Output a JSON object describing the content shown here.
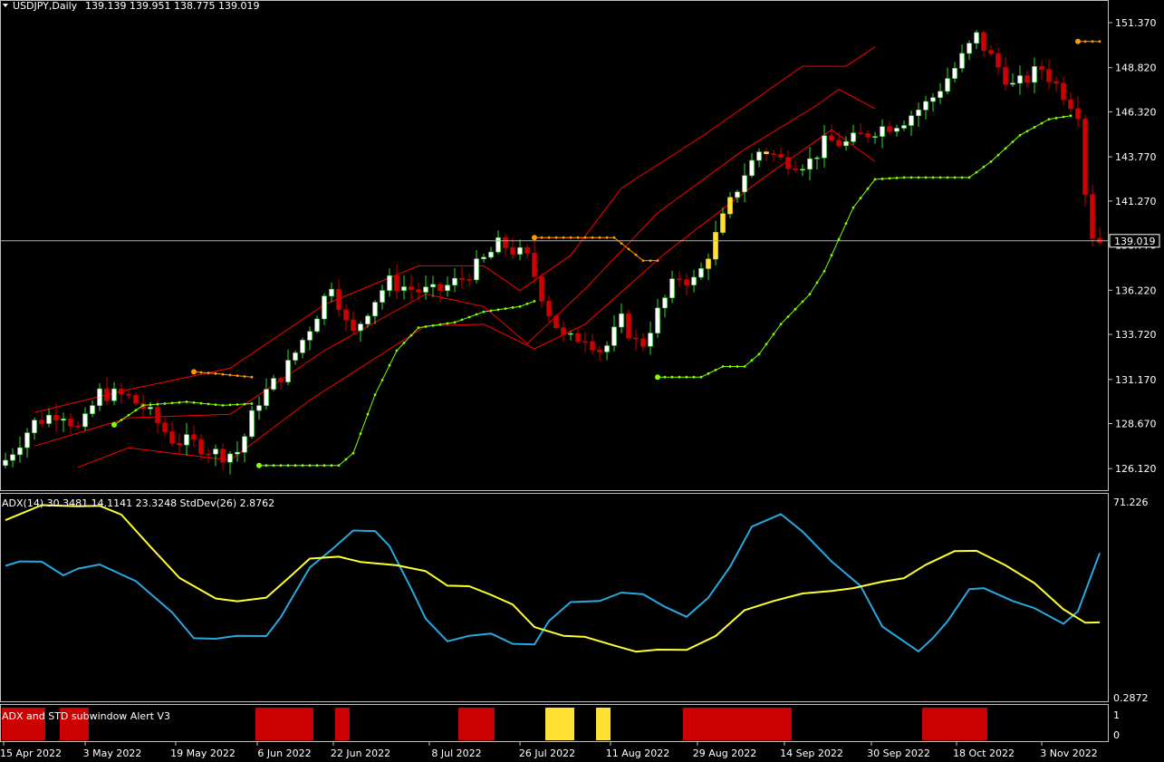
{
  "header": {
    "symbol": "USDJPY,Daily",
    "ohlc": "139.139 139.951 138.775 139.019"
  },
  "sub1_header": "ADX(14) 30.3481 14.1141 23.3248  StdDev(26) 2.8762",
  "sub2_header": "ADX and STD subwindow Alert V3",
  "colors": {
    "background": "#000000",
    "bull_candle": "#ffffff",
    "bear_candle": "#cc0000",
    "highlight_candle": "#ffe033",
    "keltner": "#ff0000",
    "stop_up": "#7fff00",
    "stop_down": "#ff9900",
    "adx_line": "#29a8e0",
    "stddev_line": "#ffff33",
    "alert_red": "#cc0000",
    "alert_yellow": "#ffe033",
    "border": "#c0c0c0"
  },
  "price_axis": {
    "ticks": [
      "151.370",
      "148.820",
      "146.320",
      "143.770",
      "141.270",
      "138.770",
      "136.220",
      "133.720",
      "131.170",
      "128.670",
      "126.120"
    ],
    "current_price": "139.019"
  },
  "sub1_axis": {
    "max": "71.226",
    "min": "0.2872"
  },
  "sub2_axis": {
    "top": "1",
    "bottom": "0"
  },
  "x_axis": {
    "dates": [
      "15 Apr 2022",
      "3 May 2022",
      "19 May 2022",
      "6 Jun 2022",
      "22 Jun 2022",
      "8 Jul 2022",
      "26 Jul 2022",
      "11 Aug 2022",
      "29 Aug 2022",
      "14 Sep 2022",
      "30 Sep 2022",
      "18 Oct 2022",
      "3 Nov 2022"
    ]
  },
  "chart_data": [
    {
      "type": "candlestick",
      "title": "USDJPY,Daily",
      "y_range": [
        124.9,
        152.6
      ],
      "current_price": 139.019,
      "close_path": [
        [
          0,
          126.6
        ],
        [
          3,
          128.7
        ],
        [
          6,
          129.4
        ],
        [
          8,
          128.2
        ],
        [
          10,
          130.4
        ],
        [
          13,
          130.2
        ],
        [
          15,
          129.5
        ],
        [
          18,
          127.7
        ],
        [
          20,
          127.6
        ],
        [
          23,
          126.9
        ],
        [
          25,
          127.1
        ],
        [
          27,
          129.9
        ],
        [
          30,
          131.7
        ],
        [
          33,
          134.5
        ],
        [
          35,
          136.7
        ],
        [
          37,
          133.5
        ],
        [
          39,
          135.3
        ],
        [
          41,
          136.7
        ],
        [
          44,
          136.2
        ],
        [
          46,
          136.1
        ],
        [
          49,
          136.9
        ],
        [
          51,
          137.8
        ],
        [
          53,
          138.9
        ],
        [
          56,
          138.0
        ],
        [
          58,
          135.2
        ],
        [
          60,
          133.3
        ],
        [
          62,
          133.7
        ],
        [
          64,
          132.7
        ],
        [
          66,
          134.5
        ],
        [
          68,
          132.9
        ],
        [
          70,
          135.1
        ],
        [
          72,
          137.0
        ],
        [
          74,
          136.7
        ],
        [
          77,
          140.4
        ],
        [
          79,
          142.7
        ],
        [
          81,
          144.3
        ],
        [
          83,
          143.6
        ],
        [
          86,
          143.4
        ],
        [
          88,
          144.7
        ],
        [
          90,
          144.5
        ],
        [
          93,
          145.3
        ],
        [
          96,
          145.8
        ],
        [
          99,
          146.9
        ],
        [
          102,
          149.0
        ],
        [
          104,
          150.6
        ],
        [
          106,
          149.1
        ],
        [
          108,
          147.7
        ],
        [
          111,
          148.8
        ],
        [
          113,
          147.6
        ],
        [
          115,
          146.3
        ],
        [
          116,
          139.7
        ],
        [
          117,
          139.0
        ]
      ],
      "highlighted_bars": [
        [
          75,
          77
        ],
        [
          81,
          81
        ]
      ],
      "keltner_upper": [
        [
          4,
          129.3
        ],
        [
          17,
          130.6
        ],
        [
          31,
          131.8
        ],
        [
          44,
          135.4
        ],
        [
          57,
          137.6
        ],
        [
          66,
          137.6
        ],
        [
          71,
          136.2
        ],
        [
          78,
          138.2
        ],
        [
          85,
          142.0
        ],
        [
          96,
          144.9
        ],
        [
          110,
          148.9
        ],
        [
          116,
          148.9
        ],
        [
          120,
          150.0
        ]
      ],
      "keltner_middle": [
        [
          4,
          127.4
        ],
        [
          17,
          129.0
        ],
        [
          31,
          129.2
        ],
        [
          44,
          132.8
        ],
        [
          58,
          136.0
        ],
        [
          66,
          135.3
        ],
        [
          72,
          133.2
        ],
        [
          80,
          136.3
        ],
        [
          90,
          140.6
        ],
        [
          102,
          144.2
        ],
        [
          112,
          146.7
        ],
        [
          115,
          147.6
        ],
        [
          120,
          146.5
        ]
      ],
      "keltner_lower": [
        [
          10,
          126.2
        ],
        [
          17,
          127.3
        ],
        [
          31,
          126.6
        ],
        [
          42,
          130.0
        ],
        [
          58,
          134.2
        ],
        [
          66,
          134.3
        ],
        [
          73,
          132.9
        ],
        [
          80,
          134.3
        ],
        [
          91,
          138.3
        ],
        [
          104,
          142.4
        ],
        [
          114,
          145.3
        ],
        [
          120,
          143.5
        ]
      ],
      "stop_dots": [
        {
          "trend": "up",
          "points": [
            [
              15,
              128.6
            ],
            [
              19,
              129.7
            ],
            [
              25,
              129.9
            ],
            [
              30,
              129.7
            ],
            [
              34,
              129.8
            ]
          ]
        },
        {
          "trend": "down",
          "points": [
            [
              26,
              131.6
            ],
            [
              29,
              131.5
            ],
            [
              34,
              131.3
            ]
          ]
        },
        {
          "trend": "up",
          "points": [
            [
              35,
              126.3
            ],
            [
              46,
              126.3
            ],
            [
              48,
              127.0
            ],
            [
              51,
              130.3
            ],
            [
              54,
              132.8
            ],
            [
              57,
              134.1
            ],
            [
              62,
              134.4
            ],
            [
              66,
              135.0
            ],
            [
              71,
              135.3
            ],
            [
              73,
              135.6
            ]
          ]
        },
        {
          "trend": "down",
          "points": [
            [
              73,
              139.2
            ],
            [
              84,
              139.2
            ],
            [
              88,
              137.9
            ],
            [
              90,
              137.9
            ]
          ]
        },
        {
          "trend": "up",
          "points": [
            [
              90,
              131.3
            ],
            [
              96,
              131.3
            ],
            [
              99,
              131.9
            ],
            [
              102,
              131.9
            ],
            [
              104,
              132.6
            ],
            [
              107,
              134.3
            ],
            [
              111,
              136.0
            ],
            [
              113,
              137.3
            ],
            [
              117,
              140.9
            ],
            [
              120,
              142.5
            ],
            [
              124,
              142.6
            ],
            [
              133,
              142.6
            ],
            [
              136,
              143.5
            ],
            [
              140,
              145.0
            ],
            [
              144,
              145.9
            ],
            [
              147,
              146.1
            ]
          ]
        },
        {
          "trend": "down",
          "points": [
            [
              148,
              150.3
            ],
            [
              151,
              150.3
            ]
          ]
        }
      ]
    },
    {
      "type": "line",
      "title": "ADX(14) 30.3481 14.1141 23.3248  StdDev(26) 2.8762",
      "y_range": [
        0.2872,
        71.226
      ],
      "series": [
        {
          "name": "ADX(14)",
          "points": [
            [
              0,
              48.6
            ],
            [
              2,
              50.2
            ],
            [
              5,
              50.1
            ],
            [
              8,
              45.2
            ],
            [
              10,
              47.6
            ],
            [
              13,
              49.1
            ],
            [
              18,
              43.1
            ],
            [
              23,
              31.9
            ],
            [
              26,
              22.6
            ],
            [
              29,
              22.4
            ],
            [
              32,
              23.5
            ],
            [
              36,
              23.4
            ],
            [
              38,
              30.2
            ],
            [
              42,
              48.0
            ],
            [
              45,
              54.4
            ],
            [
              48,
              61.3
            ],
            [
              51,
              61.1
            ],
            [
              53,
              55.7
            ],
            [
              56,
              40.4
            ],
            [
              58,
              29.6
            ],
            [
              61,
              21.5
            ],
            [
              64,
              23.5
            ],
            [
              67,
              24.3
            ],
            [
              70,
              20.6
            ],
            [
              73,
              20.4
            ],
            [
              75,
              28.8
            ],
            [
              78,
              35.6
            ],
            [
              82,
              36.0
            ],
            [
              85,
              39.0
            ],
            [
              88,
              38.4
            ],
            [
              91,
              33.9
            ],
            [
              94,
              30.3
            ],
            [
              97,
              37.2
            ],
            [
              100,
              48.3
            ],
            [
              103,
              62.7
            ],
            [
              107,
              67.2
            ],
            [
              110,
              60.9
            ],
            [
              114,
              50.2
            ],
            [
              118,
              41.4
            ],
            [
              121,
              26.8
            ],
            [
              126,
              17.9
            ],
            [
              128,
              22.7
            ],
            [
              130,
              28.7
            ],
            [
              133,
              40.2
            ],
            [
              135,
              40.6
            ],
            [
              139,
              36.0
            ],
            [
              142,
              33.4
            ],
            [
              146,
              27.8
            ],
            [
              148,
              32.3
            ],
            [
              151,
              53.2
            ]
          ]
        },
        {
          "name": "StdDev(26)",
          "points": [
            [
              0,
              65.0
            ],
            [
              5,
              70.4
            ],
            [
              10,
              70.0
            ],
            [
              13,
              70.2
            ],
            [
              16,
              67.0
            ],
            [
              20,
              55.5
            ],
            [
              24,
              44.3
            ],
            [
              29,
              36.9
            ],
            [
              32,
              35.9
            ],
            [
              36,
              37.2
            ],
            [
              39,
              44.1
            ],
            [
              42,
              51.2
            ],
            [
              46,
              51.9
            ],
            [
              49,
              50.0
            ],
            [
              54,
              48.8
            ],
            [
              58,
              46.7
            ],
            [
              61,
              41.5
            ],
            [
              64,
              41.3
            ],
            [
              67,
              38.2
            ],
            [
              70,
              34.7
            ],
            [
              73,
              26.6
            ],
            [
              77,
              23.5
            ],
            [
              80,
              23.1
            ],
            [
              84,
              20.0
            ],
            [
              87,
              17.8
            ],
            [
              90,
              18.5
            ],
            [
              94,
              18.4
            ],
            [
              98,
              23.4
            ],
            [
              102,
              32.7
            ],
            [
              106,
              36.0
            ],
            [
              110,
              38.7
            ],
            [
              114,
              39.6
            ],
            [
              117,
              40.6
            ],
            [
              121,
              42.9
            ],
            [
              124,
              44.2
            ],
            [
              127,
              49.0
            ],
            [
              131,
              53.9
            ],
            [
              134,
              54.0
            ],
            [
              138,
              48.8
            ],
            [
              142,
              42.4
            ],
            [
              146,
              33.0
            ],
            [
              149,
              28.2
            ],
            [
              151,
              28.3
            ]
          ]
        }
      ]
    },
    {
      "type": "bar",
      "title": "ADX and STD subwindow Alert V3",
      "y_range": [
        0,
        1
      ],
      "segments": [
        {
          "start": 0,
          "end": 5,
          "value": 1,
          "color": "red"
        },
        {
          "start": 8,
          "end": 11,
          "value": 1,
          "color": "red"
        },
        {
          "start": 35,
          "end": 42,
          "value": 1,
          "color": "red"
        },
        {
          "start": 46,
          "end": 47,
          "value": 1,
          "color": "red"
        },
        {
          "start": 63,
          "end": 67,
          "value": 1,
          "color": "red"
        },
        {
          "start": 75,
          "end": 78,
          "value": 1,
          "color": "yellow"
        },
        {
          "start": 82,
          "end": 83,
          "value": 1,
          "color": "yellow"
        },
        {
          "start": 94,
          "end": 108,
          "value": 1,
          "color": "red"
        },
        {
          "start": 127,
          "end": 135,
          "value": 1,
          "color": "red"
        }
      ]
    }
  ]
}
